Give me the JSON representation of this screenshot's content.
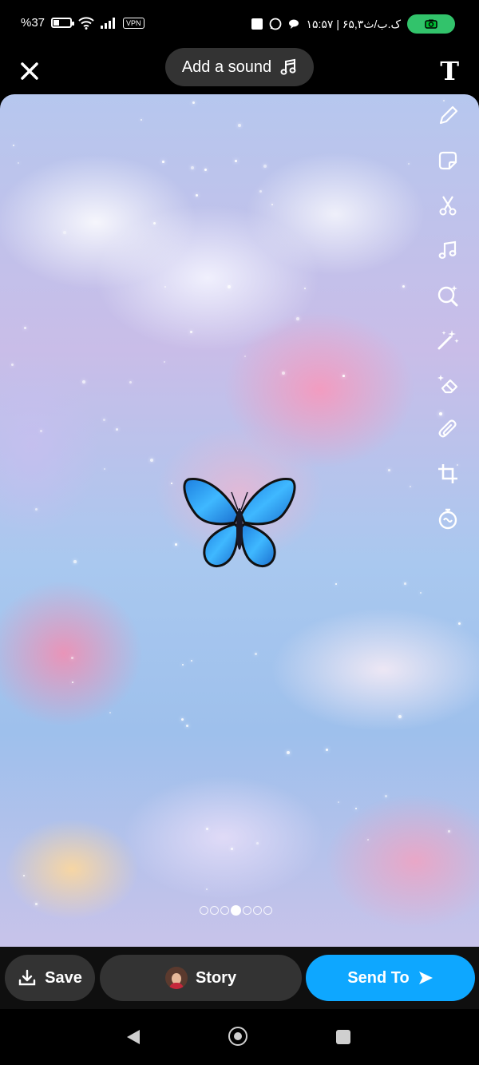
{
  "status_bar": {
    "battery_text": "%37",
    "battery_level": 0.37,
    "vpn_badge": "VPN",
    "clock_text": "۱۵:۵۷ | ۶۵,۳ک.ب/ث"
  },
  "top_bar": {
    "add_sound_label": "Add a sound",
    "text_tool_label": "T"
  },
  "tools": [
    "pencil-icon",
    "sticker-icon",
    "scissors-icon",
    "music-icon",
    "lens-search-icon",
    "magic-wand-icon",
    "eraser-icon",
    "paperclip-icon",
    "crop-icon",
    "timer-icon"
  ],
  "pagination": {
    "count": 7,
    "active_index": 3
  },
  "bottom_bar": {
    "save_label": "Save",
    "story_label": "Story",
    "send_label": "Send To"
  },
  "colors": {
    "send_button": "#0ea7ff",
    "camera_pill": "#32c36b",
    "butterfly": "#2a9df4"
  }
}
